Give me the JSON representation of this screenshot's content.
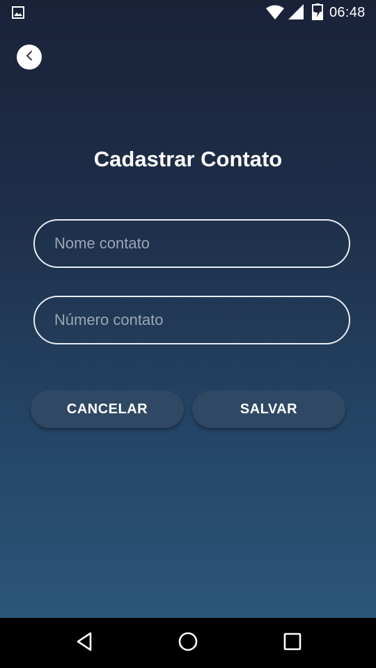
{
  "status_bar": {
    "time": "06:48",
    "icons": [
      "gallery-icon",
      "wifi-icon",
      "signal-icon",
      "battery-icon"
    ]
  },
  "header": {
    "back_icon": "chevron-left-icon",
    "title": "Cadastrar Contato"
  },
  "form": {
    "name_field": {
      "value": "",
      "placeholder": "Nome contato"
    },
    "number_field": {
      "value": "",
      "placeholder": "Número contato"
    }
  },
  "actions": {
    "cancel_label": "CANCELAR",
    "save_label": "SALVAR"
  },
  "nav_bar": {
    "icons": [
      "back-triangle-icon",
      "home-circle-icon",
      "recents-square-icon"
    ]
  },
  "colors": {
    "background_top": "#1a2238",
    "background_bottom": "#2b5678",
    "button_bg": "#2f4864",
    "field_border": "#e9eef5",
    "placeholder": "#9aa6b6"
  }
}
